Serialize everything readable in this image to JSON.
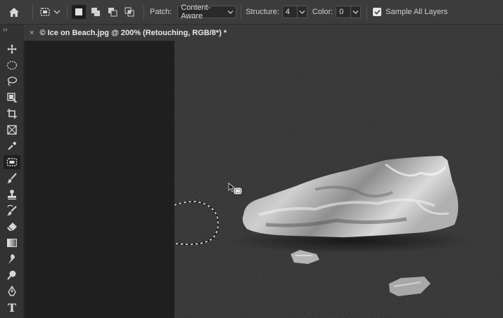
{
  "options_bar": {
    "patch_label": "Patch:",
    "patch_value": "Content-Aware",
    "structure_label": "Structure:",
    "structure_value": "4",
    "color_label": "Color:",
    "color_value": "0",
    "sample_all_layers_label": "Sample All Layers",
    "sample_all_layers_checked": true
  },
  "panel_collapse_glyph": "››",
  "document_tab": {
    "close_glyph": "×",
    "title": "© Ice on Beach.jpg @ 200% (Retouching, RGB/8*) *"
  },
  "tools": [
    {
      "name": "move-tool",
      "icon": "move-icon"
    },
    {
      "name": "elliptical-marquee-tool",
      "icon": "ellipse-marquee-icon"
    },
    {
      "name": "lasso-tool",
      "icon": "lasso-icon"
    },
    {
      "name": "object-selection-tool",
      "icon": "object-selection-icon"
    },
    {
      "name": "crop-tool",
      "icon": "crop-icon"
    },
    {
      "name": "frame-tool",
      "icon": "frame-icon"
    },
    {
      "name": "eyedropper-tool",
      "icon": "eyedropper-icon"
    },
    {
      "name": "patch-tool",
      "icon": "patch-icon",
      "active": true
    },
    {
      "name": "brush-tool",
      "icon": "brush-icon"
    },
    {
      "name": "clone-stamp-tool",
      "icon": "stamp-icon"
    },
    {
      "name": "history-brush-tool",
      "icon": "history-brush-icon"
    },
    {
      "name": "eraser-tool",
      "icon": "eraser-icon"
    },
    {
      "name": "gradient-tool",
      "icon": "gradient-icon"
    },
    {
      "name": "smudge-tool",
      "icon": "smudge-icon"
    },
    {
      "name": "dodge-tool",
      "icon": "dodge-icon"
    },
    {
      "name": "pen-tool",
      "icon": "pen-icon"
    },
    {
      "name": "type-tool",
      "icon": "type-icon",
      "glyph": "T"
    }
  ],
  "colors": {
    "options_bar_bg": "#3c3c3c",
    "toolbar_bg": "#323232",
    "pasteboard_bg": "#1f1f1f",
    "sand": "#262626"
  }
}
